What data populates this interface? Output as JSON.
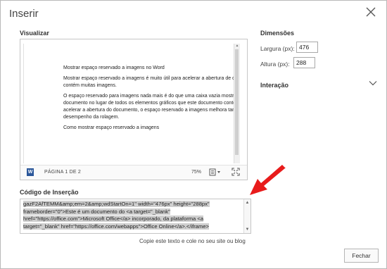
{
  "dialog": {
    "title": "Inserir",
    "close_button_label": "Fechar"
  },
  "preview": {
    "heading": "Visualizar",
    "document_lines": [
      "Mostrar espaço reservado a imagens no Word",
      "Mostrar espaço reservado a imagens é muito útil para acelerar a abertura de docu",
      "contém muitas imagens.",
      "O espaço reservado para imagens nada mais é do que uma caixa vazia mostrada d",
      "documento no lugar de todos os elementos gráficos que este documento contém",
      "acelerar a abertura do documento, o espaço reservado a imagens melhora també",
      "desempenho da rolagem.",
      "Como mostrar espaço reservado a imagens"
    ],
    "status": {
      "page_indicator": "PÁGINA 1 DE 2",
      "zoom": "75%",
      "word_icon_letter": "W"
    }
  },
  "embed": {
    "heading": "Código de Inserção",
    "code_lines": [
      "gazF2AfTEMM&amp;em=2&amp;wdStartOn=1\" width=\"476px\" height=\"288px\"",
      "frameborder=\"0\">Este é um documento do <a target=\"_blank\"",
      "href=\"https://office.com\">Microsoft Office</a> incorporado, da plataforma <a",
      "target=\"_blank\" href=\"https://office.com/webapps\">Office Online</a>.</iframe>"
    ],
    "hint": "Copie este texto e cole no seu site ou blog"
  },
  "dimensions": {
    "heading": "Dimensões",
    "width_label": "Largura (px):",
    "width_value": "476",
    "height_label": "Altura (px):",
    "height_value": "288"
  },
  "interaction": {
    "heading": "Interação"
  },
  "colors": {
    "annotation_arrow": "#e81b1b",
    "word_blue": "#2b579a",
    "selection_highlight": "#cfcfcf"
  },
  "icons": [
    "close-icon",
    "word-icon",
    "view-mode-icon",
    "fit-to-window-icon",
    "chevron-down-icon",
    "red-arrow-annotation"
  ]
}
